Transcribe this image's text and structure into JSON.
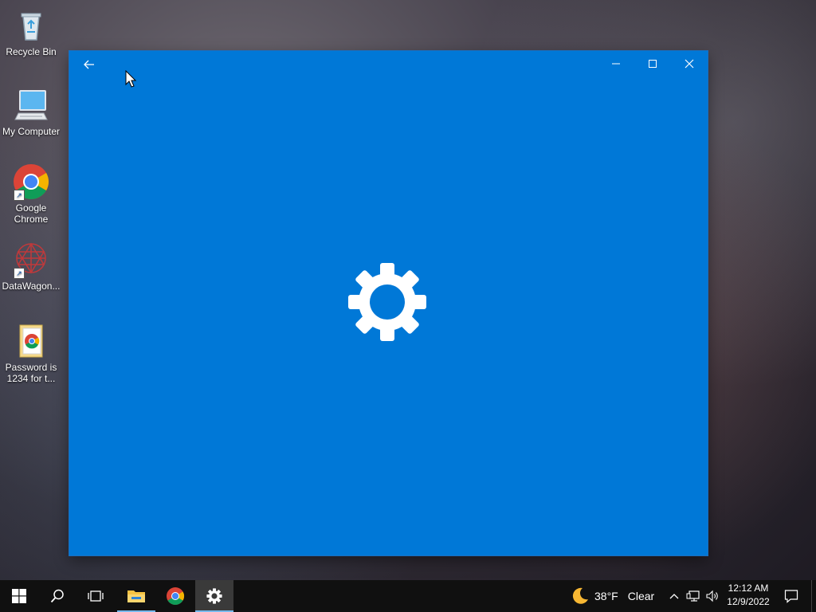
{
  "desktop": {
    "icons": [
      {
        "label": "Recycle Bin",
        "icon": "recycle-bin-icon"
      },
      {
        "label": "My Computer",
        "icon": "computer-icon"
      },
      {
        "label": "Google Chrome",
        "icon": "chrome-icon"
      },
      {
        "label": "DataWagon...",
        "icon": "datawagon-icon"
      },
      {
        "label": "Password is 1234 for t...",
        "icon": "document-icon"
      }
    ]
  },
  "window": {
    "app": "Settings",
    "state": "splash-loading",
    "background_color": "#0078d7",
    "controls": [
      "back",
      "minimize",
      "maximize",
      "close"
    ]
  },
  "taskbar": {
    "pinned": [
      "start",
      "search",
      "task-view",
      "file-explorer",
      "google-chrome",
      "settings"
    ],
    "active_app": "settings",
    "weather": {
      "temp": "38°F",
      "condition": "Clear",
      "icon": "moon-icon"
    },
    "tray_icons": [
      "chevron-up-icon",
      "network-icon",
      "volume-icon"
    ],
    "clock": {
      "time": "12:12 AM",
      "date": "12/9/2022"
    },
    "notification_icon": "notification-icon"
  },
  "colors": {
    "accent": "#0078d7",
    "taskbar": "#101010",
    "active_underline": "#76b9ed"
  }
}
